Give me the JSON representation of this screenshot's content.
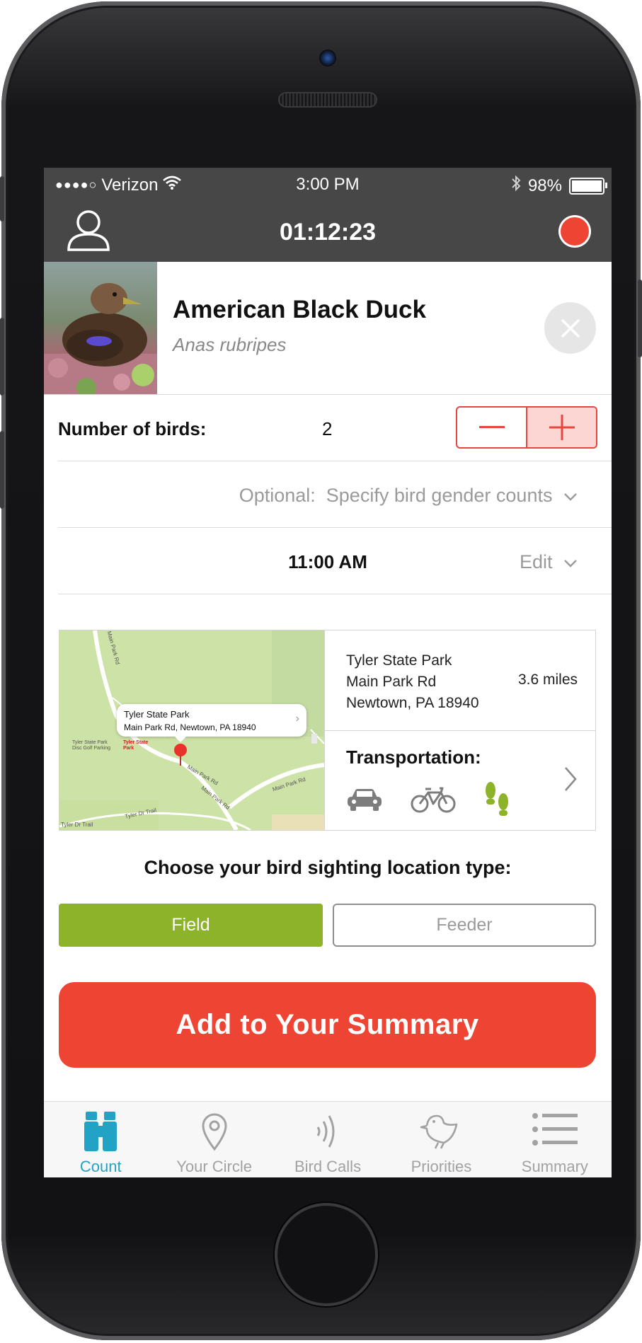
{
  "status_bar": {
    "signal": "●●●●○",
    "carrier": "Verizon",
    "time": "3:00 PM",
    "battery": "98%",
    "battery_level": 0.98
  },
  "header": {
    "timer": "01:12:23",
    "user_icon": "user-icon",
    "record_color": "#ee4433"
  },
  "species": {
    "common_name": "American Black Duck",
    "scientific_name": "Anas rubripes"
  },
  "count": {
    "label": "Number of birds:",
    "value": "2",
    "minus": "—",
    "plus": "+"
  },
  "gender": {
    "prefix": "Optional:",
    "text": "Specify bird gender counts"
  },
  "time_row": {
    "time": "11:00 AM",
    "edit_label": "Edit"
  },
  "location": {
    "map_tooltip_title": "Tyler State Park",
    "map_tooltip_address": "Main Park Rd, Newtown, PA 18940",
    "map_labels": {
      "main_park_rd": "Main Park Rd",
      "tyler_golf": "Tyler State Park Disc Golf Parking",
      "tyler_park": "Tyler State Park",
      "tyler_dr_trail": "Tyler Dr Trail"
    },
    "name": "Tyler State Park",
    "street": "Main Park Rd",
    "city": "Newtown, PA 18940",
    "distance": "3.6 miles",
    "transportation_label": "Transportation:",
    "modes": [
      "car-icon",
      "bicycle-icon",
      "footprints-icon"
    ],
    "selected_mode": "footprints-icon"
  },
  "location_type": {
    "title": "Choose your bird sighting location type:",
    "options": [
      "Field",
      "Feeder"
    ],
    "selected": "Field"
  },
  "primary_action": "Add to Your Summary",
  "tabs": [
    {
      "label": "Count",
      "icon": "binoculars-icon",
      "active": true
    },
    {
      "label": "Your Circle",
      "icon": "map-pin-icon",
      "active": false
    },
    {
      "label": "Bird Calls",
      "icon": "sound-waves-icon",
      "active": false
    },
    {
      "label": "Priorities",
      "icon": "bird-icon",
      "active": false
    },
    {
      "label": "Summary",
      "icon": "list-icon",
      "active": false
    }
  ],
  "colors": {
    "accent_red": "#ee4433",
    "field_green": "#8db32b",
    "tab_active": "#22a3c6",
    "header_gray": "#474748"
  }
}
